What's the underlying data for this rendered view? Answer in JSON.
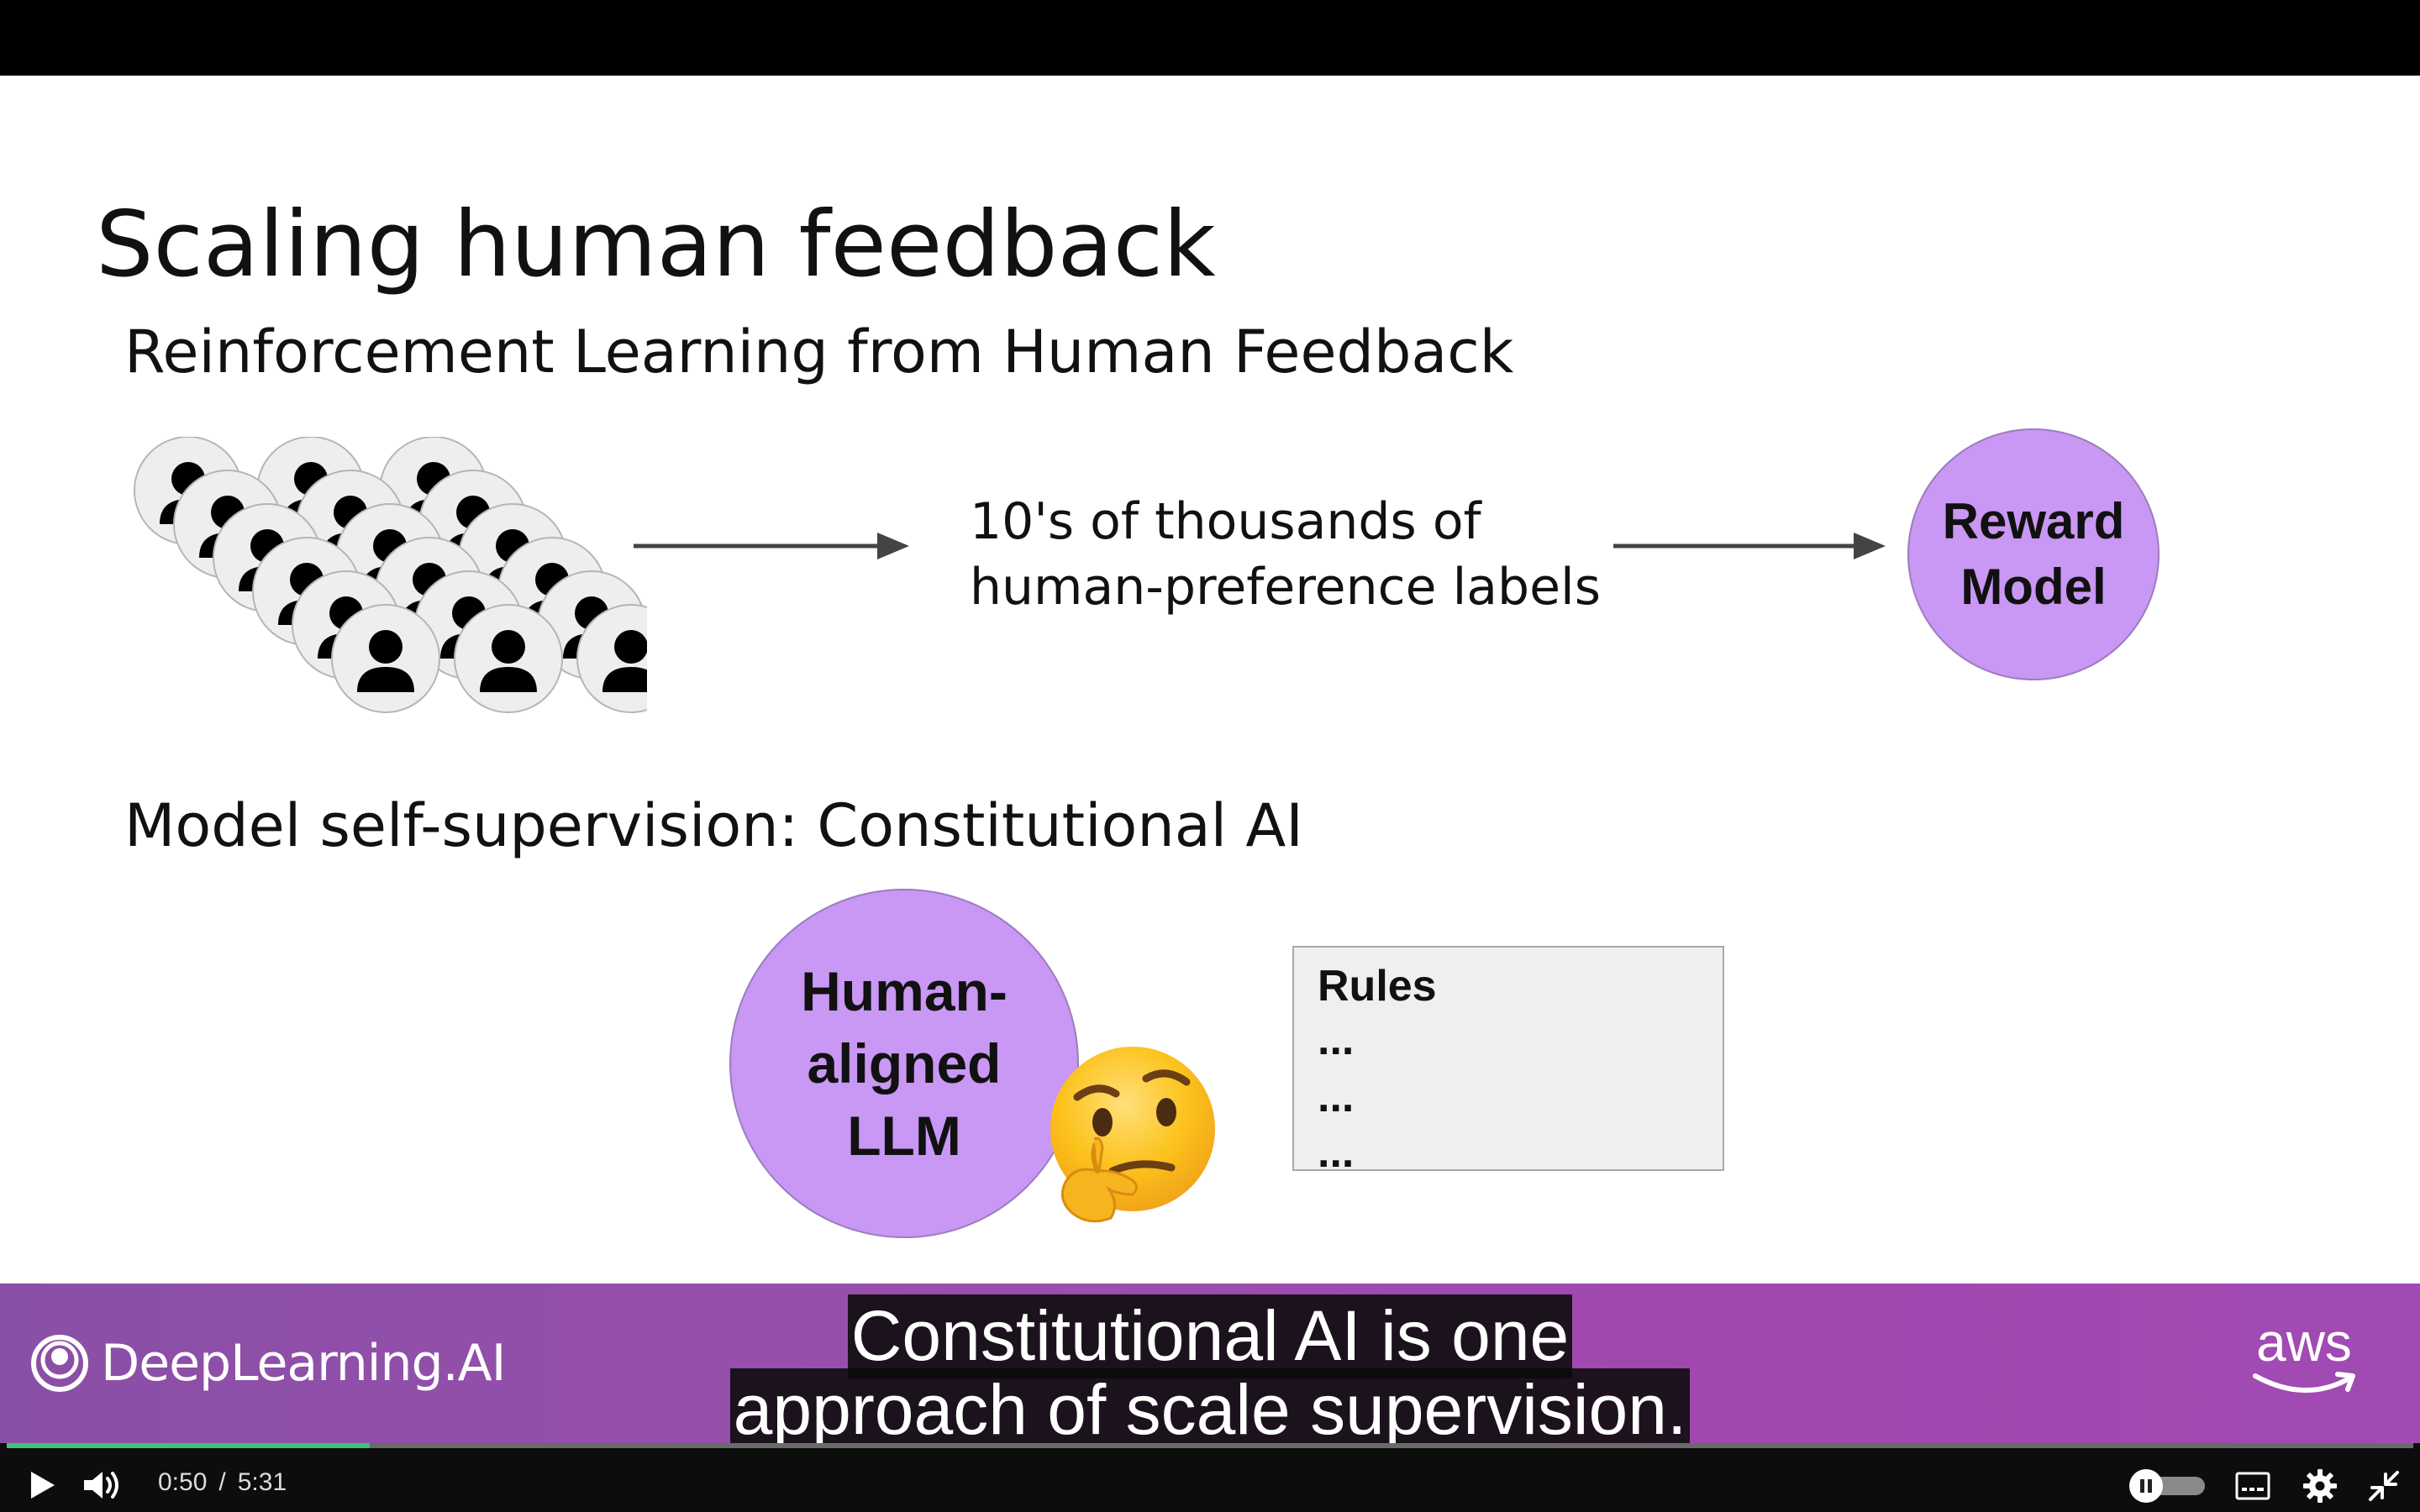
{
  "slide": {
    "title": "Scaling human feedback",
    "section_rlhf": "Reinforcement Learning from Human Feedback",
    "labels_line1": "10's of thousands of",
    "labels_line2": "human-preference labels",
    "reward_line1": "Reward",
    "reward_line2": "Model",
    "section_cai": "Model self-supervision: Constitutional AI",
    "llm_line1": "Human-",
    "llm_line2": "aligned",
    "llm_line3": "LLM",
    "rules_title": "Rules",
    "rules_items": [
      "...",
      "...",
      "..."
    ]
  },
  "branding": {
    "left_logo": "DeepLearning.AI",
    "right_logo": "aws"
  },
  "caption": {
    "line1": "Constitutional AI is one",
    "line2": "approach of scale supervision."
  },
  "player": {
    "current_time": "0:50",
    "separator": "/",
    "duration": "5:31",
    "progress_fraction": 0.151
  },
  "colors": {
    "accent_circle": "#c997f4",
    "brand_bar": "#9b4fae",
    "progress": "#3ec27a"
  },
  "icons": [
    "person-icon",
    "arrow-right-icon",
    "thinking-face-emoji",
    "deeplearning-logo-icon",
    "aws-smile-icon",
    "play-icon",
    "volume-icon",
    "autoplay-toggle-icon",
    "captions-icon",
    "settings-gear-icon",
    "exit-fullscreen-icon"
  ]
}
